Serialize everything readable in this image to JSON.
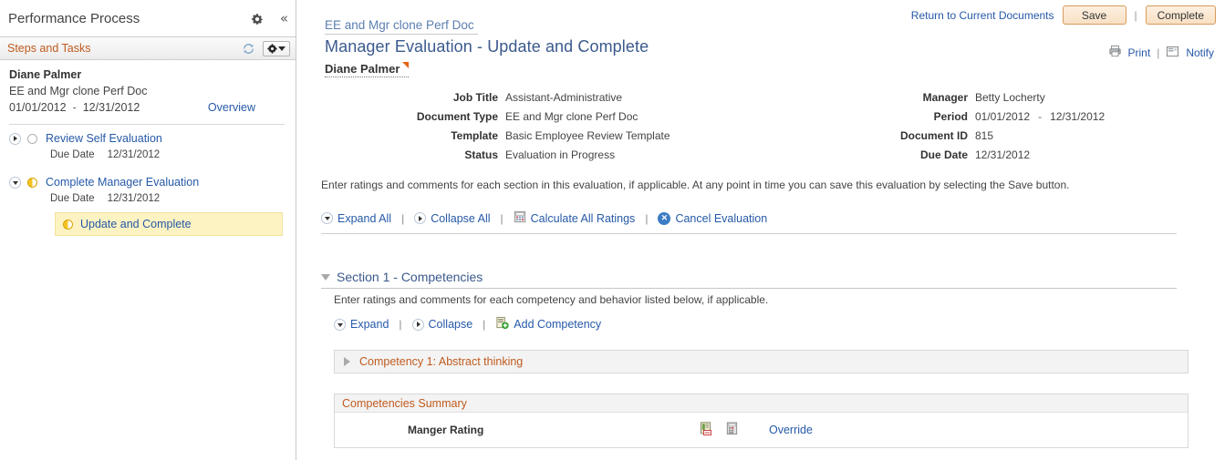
{
  "sidebar": {
    "title": "Performance Process",
    "gear_icon": "gear-icon",
    "collapse_icon": "double-chevron-left-icon",
    "steps_bar": {
      "label": "Steps and Tasks",
      "refresh_icon": "refresh-icon",
      "menu_icon": "gear-dropdown-icon"
    },
    "person": {
      "name": "Diane Palmer",
      "document": "EE and Mgr clone Perf Doc",
      "start_date": "01/01/2012",
      "date_separator": "-",
      "end_date": "12/31/2012",
      "overview_link": "Overview"
    },
    "tree": [
      {
        "label": "Review Self Evaluation",
        "expanded": false,
        "status": "not-started",
        "due_label": "Due Date",
        "due_date": "12/31/2012"
      },
      {
        "label": "Complete Manager Evaluation",
        "expanded": true,
        "status": "in-progress",
        "due_label": "Due Date",
        "due_date": "12/31/2012",
        "child": {
          "label": "Update and Complete",
          "status": "in-progress",
          "selected": true
        }
      }
    ]
  },
  "main": {
    "top_actions": {
      "return_link": "Return to Current Documents",
      "save_label": "Save",
      "separator": "|",
      "complete_label": "Complete"
    },
    "breadcrumb": "EE and Mgr clone Perf Doc",
    "page_title": "Manager Evaluation - Update and Complete",
    "subject_name": "Diane Palmer",
    "print_label": "Print",
    "print_icon": "printer-icon",
    "notify_label": "Notify",
    "notify_icon": "notify-icon",
    "pn_separator": "|",
    "details_left": [
      {
        "label": "Job Title",
        "value": "Assistant-Administrative"
      },
      {
        "label": "Document Type",
        "value": "EE and Mgr clone Perf Doc"
      },
      {
        "label": "Template",
        "value": "Basic Employee Review Template"
      },
      {
        "label": "Status",
        "value": "Evaluation in Progress"
      }
    ],
    "details_right": [
      {
        "label": "Manager",
        "value": "Betty Locherty"
      },
      {
        "label": "Period",
        "value": "01/01/2012",
        "value2": "12/31/2012",
        "dash": "-"
      },
      {
        "label": "Document ID",
        "value": "815"
      },
      {
        "label": "Due Date",
        "value": "12/31/2012"
      }
    ],
    "instructions": "Enter ratings and comments for each section in this evaluation, if applicable. At any point in time you can save this evaluation by selecting the Save button.",
    "toolbar": {
      "expand_all": "Expand All",
      "collapse_all": "Collapse All",
      "calculate_all": "Calculate All Ratings",
      "calculate_icon": "calculator-icon",
      "cancel": "Cancel Evaluation",
      "cancel_icon": "cancel-x-icon",
      "sep": "|"
    },
    "section": {
      "title": "Section 1 - Competencies",
      "instructions": "Enter ratings and comments for each competency and behavior listed below, if applicable.",
      "expand": "Expand",
      "collapse": "Collapse",
      "add_competency": "Add Competency",
      "add_icon": "add-document-icon",
      "sep": "|"
    },
    "competency": {
      "label": "Competency 1: Abstract thinking",
      "expanded": false
    },
    "summary": {
      "header": "Competencies Summary",
      "rating_label": "Manger Rating",
      "icon1": "rating-detail-icon",
      "icon2": "calculate-rating-icon",
      "override_link": "Override"
    }
  }
}
